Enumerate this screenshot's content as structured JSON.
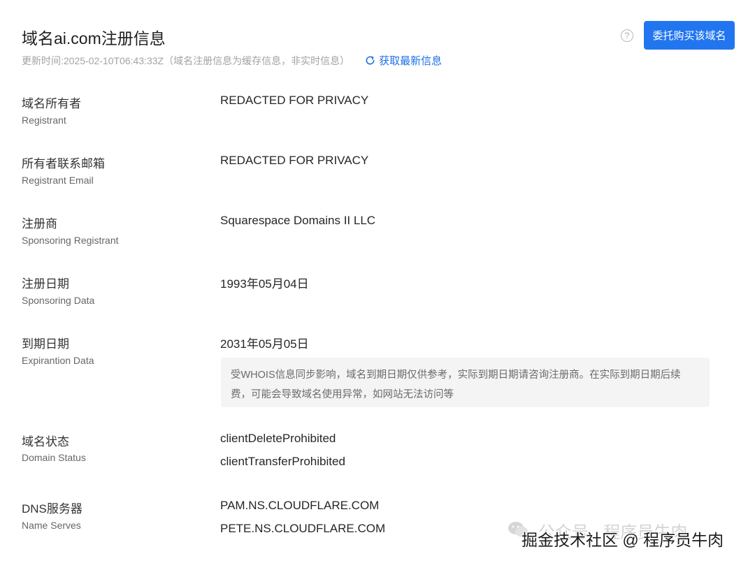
{
  "header": {
    "title": "域名ai.com注册信息",
    "updated": "更新时间:2025-02-10T06:43:33Z（域名注册信息为缓存信息，非实时信息）",
    "refresh_label": "获取最新信息",
    "help_glyph": "?",
    "buy_button": "委托购买该域名"
  },
  "rows": [
    {
      "zh": "域名所有者",
      "en": "Registrant",
      "values": [
        "REDACTED FOR PRIVACY"
      ]
    },
    {
      "zh": "所有者联系邮箱",
      "en": "Registrant Email",
      "values": [
        "REDACTED FOR PRIVACY"
      ]
    },
    {
      "zh": "注册商",
      "en": "Sponsoring Registrant",
      "values": [
        "Squarespace Domains II LLC"
      ]
    },
    {
      "zh": "注册日期",
      "en": "Sponsoring Data",
      "values": [
        "1993年05月04日"
      ]
    },
    {
      "zh": "到期日期",
      "en": "Expirantion Data",
      "values": [
        "2031年05月05日"
      ],
      "note": "受WHOIS信息同步影响，域名到期日期仅供参考，实际到期日期请咨询注册商。在实际到期日期后续费，可能会导致域名使用异常，如网站无法访问等"
    },
    {
      "zh": "域名状态",
      "en": "Domain Status",
      "values": [
        "clientDeleteProhibited",
        "clientTransferProhibited"
      ]
    },
    {
      "zh": "DNS服务器",
      "en": "Name Serves",
      "values": [
        "PAM.NS.CLOUDFLARE.COM",
        "PETE.NS.CLOUDFLARE.COM"
      ]
    }
  ],
  "watermark": {
    "back": "公众号 · 程序员牛肉",
    "front": "掘金技术社区 @ 程序员牛肉"
  },
  "colors": {
    "accent": "#2176f0",
    "link": "#1f6fe5",
    "note_bg": "#f4f4f5"
  },
  "icons": {
    "refresh": "refresh-icon",
    "help": "help-circle-icon",
    "wechat": "wechat-icon"
  }
}
